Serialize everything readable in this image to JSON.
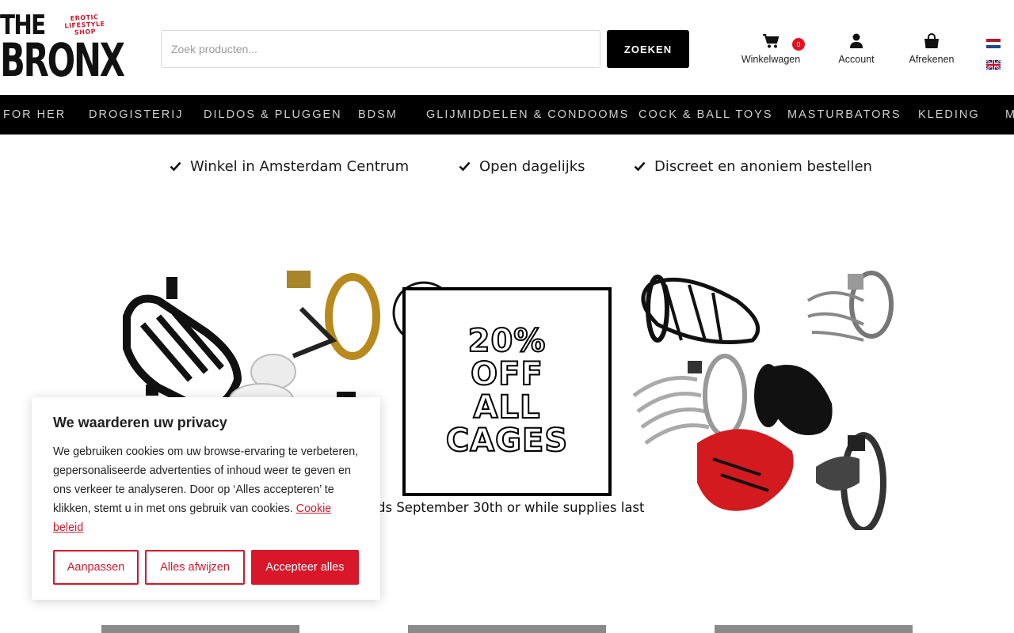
{
  "brand": {
    "line1": "THE",
    "line2": "BRONX",
    "tagline": "EROTIC LIFESTYLE SHOP"
  },
  "search": {
    "placeholder": "Zoek producten...",
    "button_label": "ZOEKEN"
  },
  "header_links": {
    "cart_label": "Winkelwagen",
    "cart_count": "0",
    "account_label": "Account",
    "checkout_label": "Afrekenen"
  },
  "nav": {
    "items": [
      "FOR HER",
      "DROGISTERIJ",
      "DILDOS & PLUGGEN",
      "BDSM",
      "GLIJMIDDELEN & CONDOOMS",
      "COCK & BALL TOYS",
      "MASTURBATORS",
      "KLEDING",
      "M"
    ]
  },
  "usps": [
    "Winkel in Amsterdam Centrum",
    "Open dagelijks",
    "Discreet en anoniem bestellen"
  ],
  "banner": {
    "headline": "20% OFF ALL CAGES",
    "headline_lines": [
      "20%",
      "OFF",
      "ALL",
      "CAGES"
    ],
    "note": "e ends September 30th or while supplies last"
  },
  "cookie_dialog": {
    "title": "We waarderen uw privacy",
    "text": "We gebruiken cookies om uw browse-ervaring te verbeteren, gepersonaliseerde advertenties of inhoud weer te geven en ons verkeer te analyseren. Door op ‘Alles accepteren’ te klikken, stemt u in met ons gebruik van cookies.",
    "link_label": "Cookie beleid",
    "customize_label": "Aanpassen",
    "reject_label": "Alles afwijzen",
    "accept_label": "Accepteer alles",
    "accent_color": "#d8172b"
  }
}
